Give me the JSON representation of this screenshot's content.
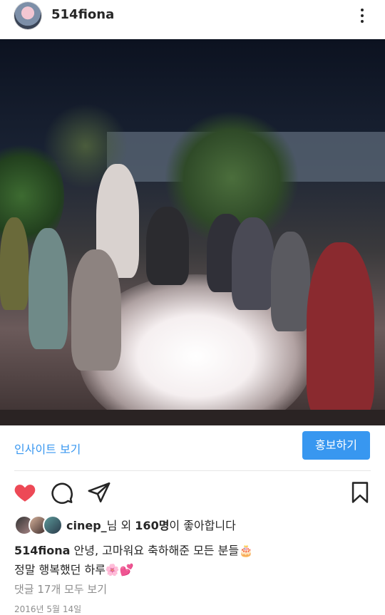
{
  "post": {
    "username": "514fiona",
    "photo_description_icon": "party-photo"
  },
  "actions": {
    "insights_label": "인사이트 보기",
    "promote_label": "홍보하기"
  },
  "likes": {
    "liker": "cinep_",
    "text_mid": "님 외 ",
    "count": "160명",
    "text_end": "이 좋아합니다"
  },
  "caption": {
    "author": "514fiona",
    "line1": " 안녕, 고마워요 축하해준 모든 분들🎂",
    "line2": "정말 행복했던 하루🌸💕"
  },
  "comments_label": "댓글 17개 모두 보기",
  "date": "2016년 5월 14일",
  "colors": {
    "accent": "#3897f0",
    "like": "#ed4956"
  }
}
